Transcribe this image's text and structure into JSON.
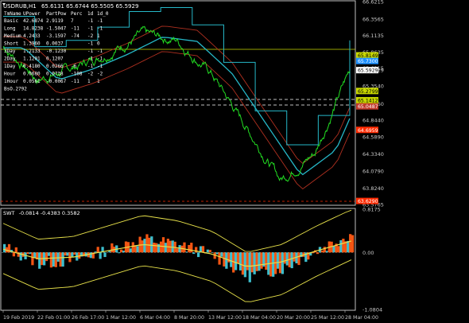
{
  "header": {
    "title": "USDRUB,H1",
    "ohlc": "65.6131 65.6744 65.5505 65.5929"
  },
  "stats_table": {
    "columns": [
      "TmName",
      "UPower",
      "PartPow",
      "Perc",
      "1d",
      "1d_0"
    ],
    "rows": [
      [
        "Basic",
        "42.6874",
        "2.9119",
        "7",
        "-1",
        "-1"
      ],
      [
        "Long",
        "14.8238",
        "-1.5047",
        "-11",
        "-1",
        "-1"
      ],
      [
        "Medium",
        "4.2433",
        "-3.1597",
        "-74",
        "-2",
        "1"
      ],
      [
        "Short",
        "1.3960",
        "0.0037",
        "",
        "-1",
        "0"
      ],
      [
        "3Day",
        "1.2133",
        "-0.1230",
        "",
        "-1",
        "-1"
      ],
      [
        "2Day",
        "1.1201",
        "0.1207",
        "",
        "-1",
        "-1"
      ],
      [
        "1Day",
        "0.4180",
        "0.0266",
        "-6",
        "-1",
        "-1"
      ],
      [
        "Hour",
        "0.0680",
        "0.0738",
        "-108",
        "-2",
        "-2"
      ],
      [
        "1Hour",
        "0.0561",
        "-0.0067",
        "-11",
        "1",
        "1"
      ]
    ],
    "footer": "BsO.2792"
  },
  "main_chart": {
    "type": "line",
    "series_name": "USDRUB,H1",
    "price_axis_labels": [
      "66.6215",
      "66.3565",
      "66.1135",
      "65.8635",
      "65.6215",
      "65.5929",
      "65.3540",
      "65.0860",
      "64.8440",
      "64.5890",
      "64.3340",
      "64.0790",
      "63.8240",
      "63.5765"
    ],
    "price_markers": [
      {
        "value": "65.8149",
        "color": "#c8d800"
      },
      {
        "value": "65.7300",
        "color": "#1e90ff"
      },
      {
        "value": "65.5929",
        "color": "#ffffff"
      },
      {
        "value": "65.2799",
        "color": "#c8d800"
      },
      {
        "value": "65.1412",
        "color": "#c8d800"
      },
      {
        "value": "65.0487",
        "color": "#c0392b"
      },
      {
        "value": "64.6959",
        "color": "#ff2a00"
      },
      {
        "value": "63.6290",
        "color": "#ff2a00"
      }
    ],
    "ylim": [
      63.5765,
      66.6215
    ]
  },
  "oscillator": {
    "title": "SWT",
    "values_text": "-0.0814 -0.4383 0.3582",
    "axis_labels": [
      "0.8175",
      "0.00",
      "-1.0804"
    ],
    "ylim": [
      -1.0804,
      0.8175
    ]
  },
  "time_axis": {
    "labels": [
      "19 Feb 2019",
      "22 Feb 01:00",
      "26 Feb 17:00",
      "1 Mar 12:00",
      "6 Mar 04:00",
      "8 Mar 20:00",
      "13 Mar 12:00",
      "18 Mar 04:00",
      "20 Mar 20:00",
      "25 Mar 12:00",
      "28 Mar 04:00"
    ]
  },
  "chart_data": [
    {
      "type": "line",
      "title": "USDRUB,H1",
      "ylim": [
        63.5765,
        66.6215
      ],
      "x": [
        "19 Feb 2019",
        "22 Feb 01:00",
        "26 Feb 17:00",
        "1 Mar 12:00",
        "6 Mar 04:00",
        "8 Mar 20:00",
        "13 Mar 12:00",
        "18 Mar 04:00",
        "20 Mar 20:00",
        "25 Mar 12:00",
        "28 Mar 04:00"
      ],
      "series": [
        {
          "name": "USDRUB,H1",
          "values": [
            65.95,
            65.45,
            65.62,
            65.85,
            66.12,
            66.05,
            65.55,
            64.75,
            63.95,
            64.35,
            65.59
          ]
        }
      ]
    },
    {
      "type": "area",
      "title": "SWT",
      "ylim": [
        -1.0804,
        0.8175
      ],
      "x": [
        "19 Feb 2019",
        "22 Feb 01:00",
        "26 Feb 17:00",
        "1 Mar 12:00",
        "6 Mar 04:00",
        "8 Mar 20:00",
        "13 Mar 12:00",
        "18 Mar 04:00",
        "20 Mar 20:00",
        "25 Mar 12:00",
        "28 Mar 04:00"
      ],
      "series": [
        {
          "values": [
            0.1,
            -0.2,
            -0.15,
            0.05,
            0.25,
            0.15,
            -0.05,
            -0.45,
            -0.3,
            0.05,
            0.36
          ]
        }
      ]
    }
  ]
}
